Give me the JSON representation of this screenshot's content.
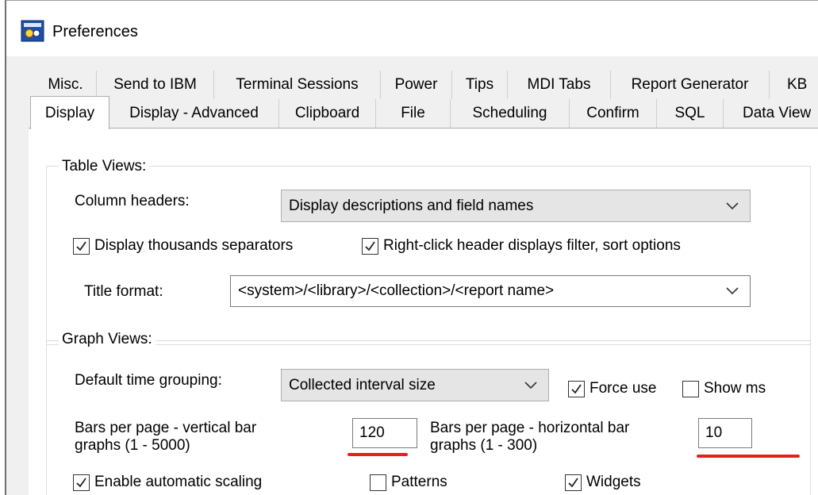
{
  "window": {
    "title": "Preferences"
  },
  "tabs_row1": [
    "Misc.",
    "Send to IBM",
    "Terminal Sessions",
    "Power",
    "Tips",
    "MDI Tabs",
    "Report Generator",
    "KB"
  ],
  "tabs_row2": [
    "Display",
    "Display - Advanced",
    "Clipboard",
    "File",
    "Scheduling",
    "Confirm",
    "SQL",
    "Data View"
  ],
  "selected_tab": "Display",
  "table_views": {
    "label": "Table Views:",
    "column_headers_label": "Column headers:",
    "column_headers_value": "Display descriptions and field names",
    "thousands_label": "Display thousands separators",
    "thousands_checked": true,
    "right_click_label": "Right-click header displays filter, sort options",
    "right_click_checked": true,
    "title_format_label": "Title format:",
    "title_format_value": "<system>/<library>/<collection>/<report name>"
  },
  "graph_views": {
    "label": "Graph Views:",
    "time_grouping_label": "Default time grouping:",
    "time_grouping_value": "Collected interval size",
    "force_use_label": "Force use",
    "force_use_checked": true,
    "show_ms_label": "Show ms",
    "show_ms_checked": false,
    "vertical_bars_label_1": "Bars per page - vertical bar",
    "vertical_bars_label_2": "graphs (1 - 5000)",
    "vertical_bars_value": "120",
    "horizontal_bars_label_1": "Bars per page - horizontal bar",
    "horizontal_bars_label_2": "graphs (1 - 300)",
    "horizontal_bars_value": "10",
    "auto_scaling_label": "Enable automatic scaling",
    "auto_scaling_checked": true,
    "patterns_label": "Patterns",
    "patterns_checked": false,
    "widgets_label": "Widgets",
    "widgets_checked": true
  },
  "annotation_color": "#e8201c"
}
